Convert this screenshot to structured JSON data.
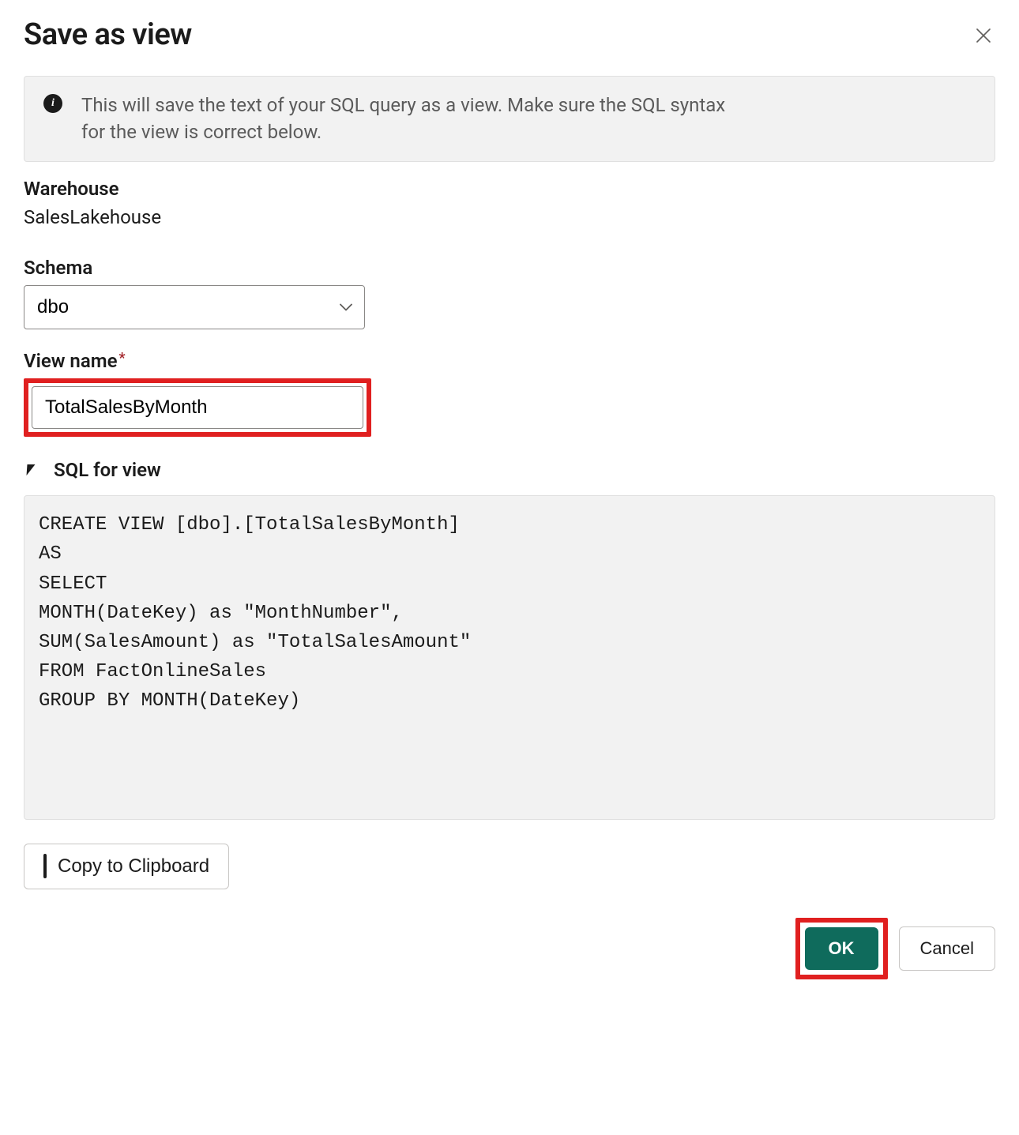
{
  "dialog": {
    "title": "Save as view",
    "infoText": "This will save the text of your SQL query as a view. Make sure the SQL syntax for the view is correct below."
  },
  "warehouse": {
    "label": "Warehouse",
    "value": "SalesLakehouse"
  },
  "schema": {
    "label": "Schema",
    "value": "dbo"
  },
  "viewName": {
    "label": "View name",
    "value": "TotalSalesByMonth"
  },
  "sqlSection": {
    "label": "SQL for view",
    "code": "CREATE VIEW [dbo].[TotalSalesByMonth]\nAS\nSELECT\nMONTH(DateKey) as \"MonthNumber\",\nSUM(SalesAmount) as \"TotalSalesAmount\"\nFROM FactOnlineSales\nGROUP BY MONTH(DateKey)"
  },
  "buttons": {
    "copy": "Copy to Clipboard",
    "ok": "OK",
    "cancel": "Cancel"
  }
}
